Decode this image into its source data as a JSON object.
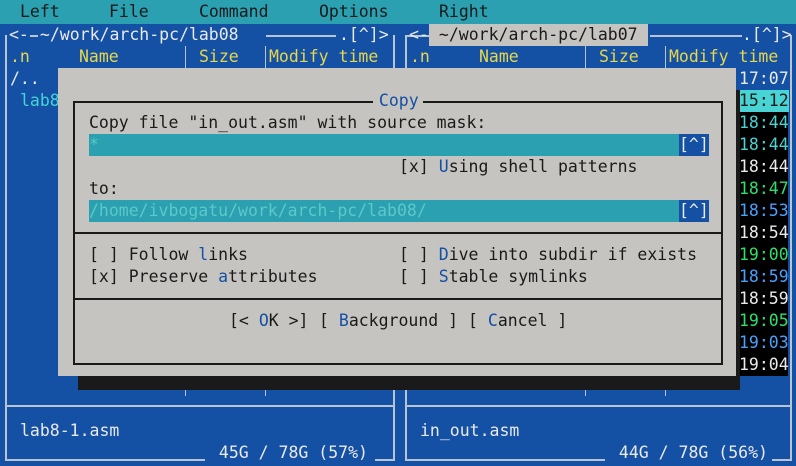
{
  "menu": {
    "left": "Left",
    "file": "File",
    "command": "Command",
    "options": "Options",
    "right": "Right"
  },
  "left_panel": {
    "path": " ~/work/arch-pc/lab08 ",
    "hist": ".[^]>",
    "arrow": "<-",
    "col_n": ".n",
    "col_name": "Name",
    "col_size": "Size",
    "col_mtime": "Modify time",
    "rows": [
      "/..",
      "lab8"
    ],
    "status_name": "lab8-1.asm",
    "disk": " 45G / 78G (57%) "
  },
  "right_panel": {
    "path": " ~/work/arch-pc/lab07 ",
    "hist": ".[^]>",
    "arrow": "<-",
    "col_n": ".n",
    "col_name": "Name",
    "col_size": "Size",
    "col_mtime": "Modify time",
    "times": [
      "17:07",
      "15:12",
      "18:44",
      "18:44",
      "18:44",
      "18:47",
      "18:53",
      "18:54",
      "19:00",
      "18:59",
      "18:59",
      "19:05",
      "19:03",
      "19:04"
    ],
    "status_name": "in_out.asm",
    "disk": " 44G / 78G (56%) "
  },
  "dialog": {
    "title": " Copy ",
    "source_label": "Copy file \"in_out.asm\" with source mask:",
    "source_value": "*",
    "hist_btn": "[^]",
    "shell_check": "[x]",
    "shell_pre": " ",
    "shell_hot": "U",
    "shell_rest": "sing shell patterns",
    "to_label": "to:",
    "to_value": "/home/ivbogatu/work/arch-pc/lab08/",
    "follow_check": "[ ]",
    "follow_pre": " Follow ",
    "follow_hot": "l",
    "follow_rest": "inks",
    "preserve_check": "[x]",
    "preserve_pre": " Preserve ",
    "preserve_hot": "a",
    "preserve_rest": "ttributes",
    "dive_check": "[ ]",
    "dive_pre": " ",
    "dive_hot": "D",
    "dive_rest": "ive into subdir if exists",
    "stable_check": "[ ]",
    "stable_pre": " ",
    "stable_hot": "S",
    "stable_rest": "table symlinks",
    "ok_pre": "[< ",
    "ok_hot": "O",
    "ok_rest": "K >]",
    "bg_pre": "[ ",
    "bg_hot": "B",
    "bg_rest": "ackground ]",
    "cancel_pre": "[ ",
    "cancel_hot": "C",
    "cancel_rest": "ancel ]"
  }
}
